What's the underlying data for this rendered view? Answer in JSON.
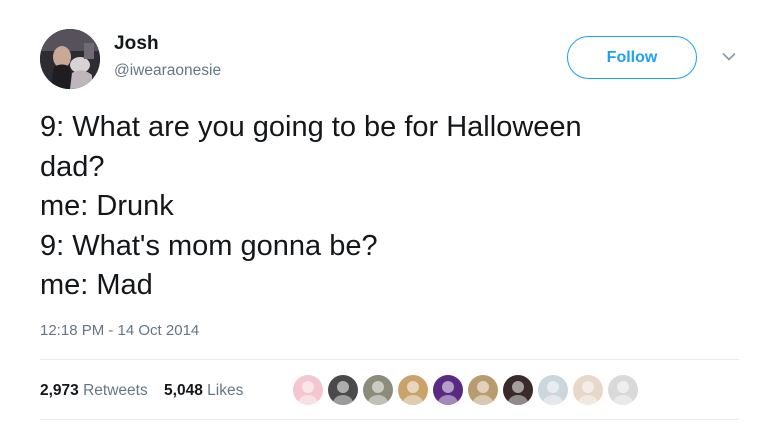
{
  "author": {
    "display_name": "Josh",
    "handle": "@iwearaonesie"
  },
  "follow_button": {
    "label": "Follow"
  },
  "tweet": {
    "lines": [
      "9: What are you going to be for Halloween",
      "dad?",
      "me: Drunk",
      "9: What's mom gonna be?",
      "me: Mad"
    ],
    "timestamp": "12:18 PM - 14 Oct 2014"
  },
  "stats": {
    "retweets_count": "2,973",
    "retweets_label": "Retweets",
    "likes_count": "5,048",
    "likes_label": "Likes"
  },
  "likers": [
    {
      "icon": "pink-lips-avatar",
      "color": "#f4c6cf"
    },
    {
      "icon": "sunglasses-face-avatar",
      "color": "#4a4a4a"
    },
    {
      "icon": "bird-avatar",
      "color": "#8c8c7a"
    },
    {
      "icon": "blonde-person-avatar",
      "color": "#c9a36a"
    },
    {
      "icon": "purple-logo-avatar",
      "color": "#5a2a82"
    },
    {
      "icon": "dog-avatar",
      "color": "#b89b6e"
    },
    {
      "icon": "dark-hair-person-avatar",
      "color": "#3a2a2a"
    },
    {
      "icon": "default-egg-avatar",
      "color": "#ccd6dd"
    },
    {
      "icon": "tan-person-avatar",
      "color": "#e7d8c9"
    },
    {
      "icon": "gray-person-avatar",
      "color": "#d9d9d9"
    }
  ],
  "colors": {
    "accent": "#1da1f2",
    "secondary_text": "#657786",
    "primary_text": "#14171a",
    "divider": "#e6ecf0"
  }
}
